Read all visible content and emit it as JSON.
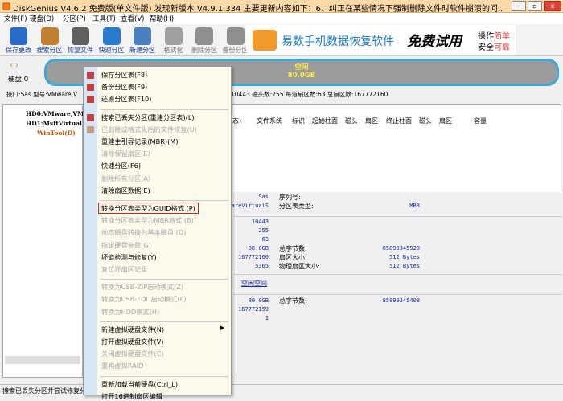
{
  "window": {
    "title": "DiskGenius V4.6.2 免费版(单文件版)   发现新版本 V4.9.1.334 主要更新内容如下：6、纠正在某些情况下强制删除文件时软件崩溃的问...",
    "minimize": "–",
    "maximize": "▫",
    "close": "x"
  },
  "menubar": [
    "文件(F)",
    "硬盘(D)",
    "分区(P)",
    "工具(T)",
    "查看(V)",
    "帮助(H)"
  ],
  "toolbar": [
    {
      "label": "保存更改",
      "icon": "save-icon",
      "color": "#2a6ac8"
    },
    {
      "label": "搜索分区",
      "icon": "search-icon",
      "color": "#c08030"
    },
    {
      "label": "恢复文件",
      "icon": "recover-icon",
      "color": "#606060"
    },
    {
      "label": "快速分区",
      "icon": "quick-partition-icon",
      "color": "#2a7ad0"
    },
    {
      "label": "新建分区",
      "icon": "new-partition-icon",
      "color": "#4a80c0"
    },
    {
      "label": "格式化",
      "icon": "format-icon",
      "color": "#a0a0a0"
    },
    {
      "label": "删除分区",
      "icon": "delete-icon",
      "color": "#909090"
    },
    {
      "label": "备份分区",
      "icon": "backup-icon",
      "color": "#909090"
    }
  ],
  "ad": {
    "text": "易数手机数据恢复软件",
    "badge": "免费试用",
    "side1": "操作",
    "side1b": "简单",
    "side2": "安全",
    "side2b": "可靠"
  },
  "disk": {
    "label": "硬盘 0",
    "free_label": "空闲",
    "free_size": "80.0GB"
  },
  "infoline": {
    "left": "接口:Sas  型号:VMware,V",
    "right": "10443  磁头数:255  每道扇区数:63  总扇区数:167772160"
  },
  "tree": [
    {
      "label": "HD0:VMware,VMware"
    },
    {
      "label": "HD1:MsftVirtual"
    },
    {
      "label": "WinTool(D)"
    }
  ],
  "table_headers": [
    "态)",
    "文件系统",
    "标识",
    "起始柱面",
    "磁头",
    "扇区",
    "终止柱面",
    "磁头",
    "扇区",
    "容量"
  ],
  "details": {
    "left_values_a": [
      "Sas",
      "areVirtualS"
    ],
    "labels_a": [
      "序列号:",
      "分区表类型:"
    ],
    "values_a": [
      "",
      "MBR"
    ],
    "left_values_b": [
      "10443",
      "255",
      "63",
      "80.0GB",
      "167772160",
      "5365"
    ],
    "labels_b": [
      "总字节数:",
      "扇区大小:",
      "物理扇区大小:"
    ],
    "values_b": [
      "85899345920",
      "512 Bytes",
      "512 Bytes"
    ],
    "section": "空闲空间",
    "left_values_c": [
      "80.0GB",
      "167772159",
      "1"
    ],
    "labels_c": [
      "总字节数:"
    ],
    "values_c": [
      "85899345408"
    ]
  },
  "status": "搜索已丢失分区并尝试修复分",
  "context_menu": [
    {
      "label": "保存分区表(F8)",
      "enabled": true,
      "icon": "save-table-icon"
    },
    {
      "label": "备份分区表(F9)",
      "enabled": true,
      "icon": "backup-table-icon"
    },
    {
      "label": "还原分区表(F10)",
      "enabled": true,
      "icon": "restore-table-icon"
    },
    {
      "sep": true
    },
    {
      "label": "搜索已丢失分区(重建分区表)(L)",
      "enabled": true,
      "icon": "search-lost-icon"
    },
    {
      "label": "已删除或格式化后的文件恢复(U)",
      "enabled": false,
      "icon": "file-recover-icon"
    },
    {
      "label": "重建主引导记录(MBR)(M)",
      "enabled": true
    },
    {
      "label": "清除保留扇区(E)",
      "enabled": false
    },
    {
      "label": "快速分区(F6)",
      "enabled": true
    },
    {
      "label": "删除所有分区(A)",
      "enabled": false
    },
    {
      "label": "清除扇区数据(E)",
      "enabled": true
    },
    {
      "sep": true
    },
    {
      "label": "转换分区表类型为GUID格式 (P)",
      "enabled": true,
      "highlight": true
    },
    {
      "label": "转换分区表类型为MBR格式 (B)",
      "enabled": false
    },
    {
      "label": "动态磁盘转换为基本磁盘 (D)",
      "enabled": false
    },
    {
      "label": "指定硬盘参数(G)",
      "enabled": false
    },
    {
      "label": "坏道检测与修复(Y)",
      "enabled": true
    },
    {
      "label": "复位坏扇区记录",
      "enabled": false
    },
    {
      "sep": true
    },
    {
      "label": "转换为USB-ZIP启动模式(Z)",
      "enabled": false
    },
    {
      "label": "转换为USB-FDD启动模式(F)",
      "enabled": false
    },
    {
      "label": "转换为HDD模式(H)",
      "enabled": false
    },
    {
      "sep": true
    },
    {
      "label": "新建虚拟硬盘文件(N)",
      "enabled": true,
      "submenu": true
    },
    {
      "label": "打开虚拟硬盘文件(V)",
      "enabled": true
    },
    {
      "label": "关闭虚拟硬盘文件(C)",
      "enabled": false
    },
    {
      "label": "重构虚拟RAID",
      "enabled": false
    },
    {
      "sep": true
    },
    {
      "label": "重新加载当前硬盘(Ctrl_L)",
      "enabled": true
    },
    {
      "label": "打开16进制扇区编辑",
      "enabled": true
    }
  ],
  "colors": {
    "highlight_border": "#d02020",
    "disk_border": "#3aa8dc",
    "free_text": "#ffe94a",
    "menu_bg": "#fcfbeb"
  }
}
